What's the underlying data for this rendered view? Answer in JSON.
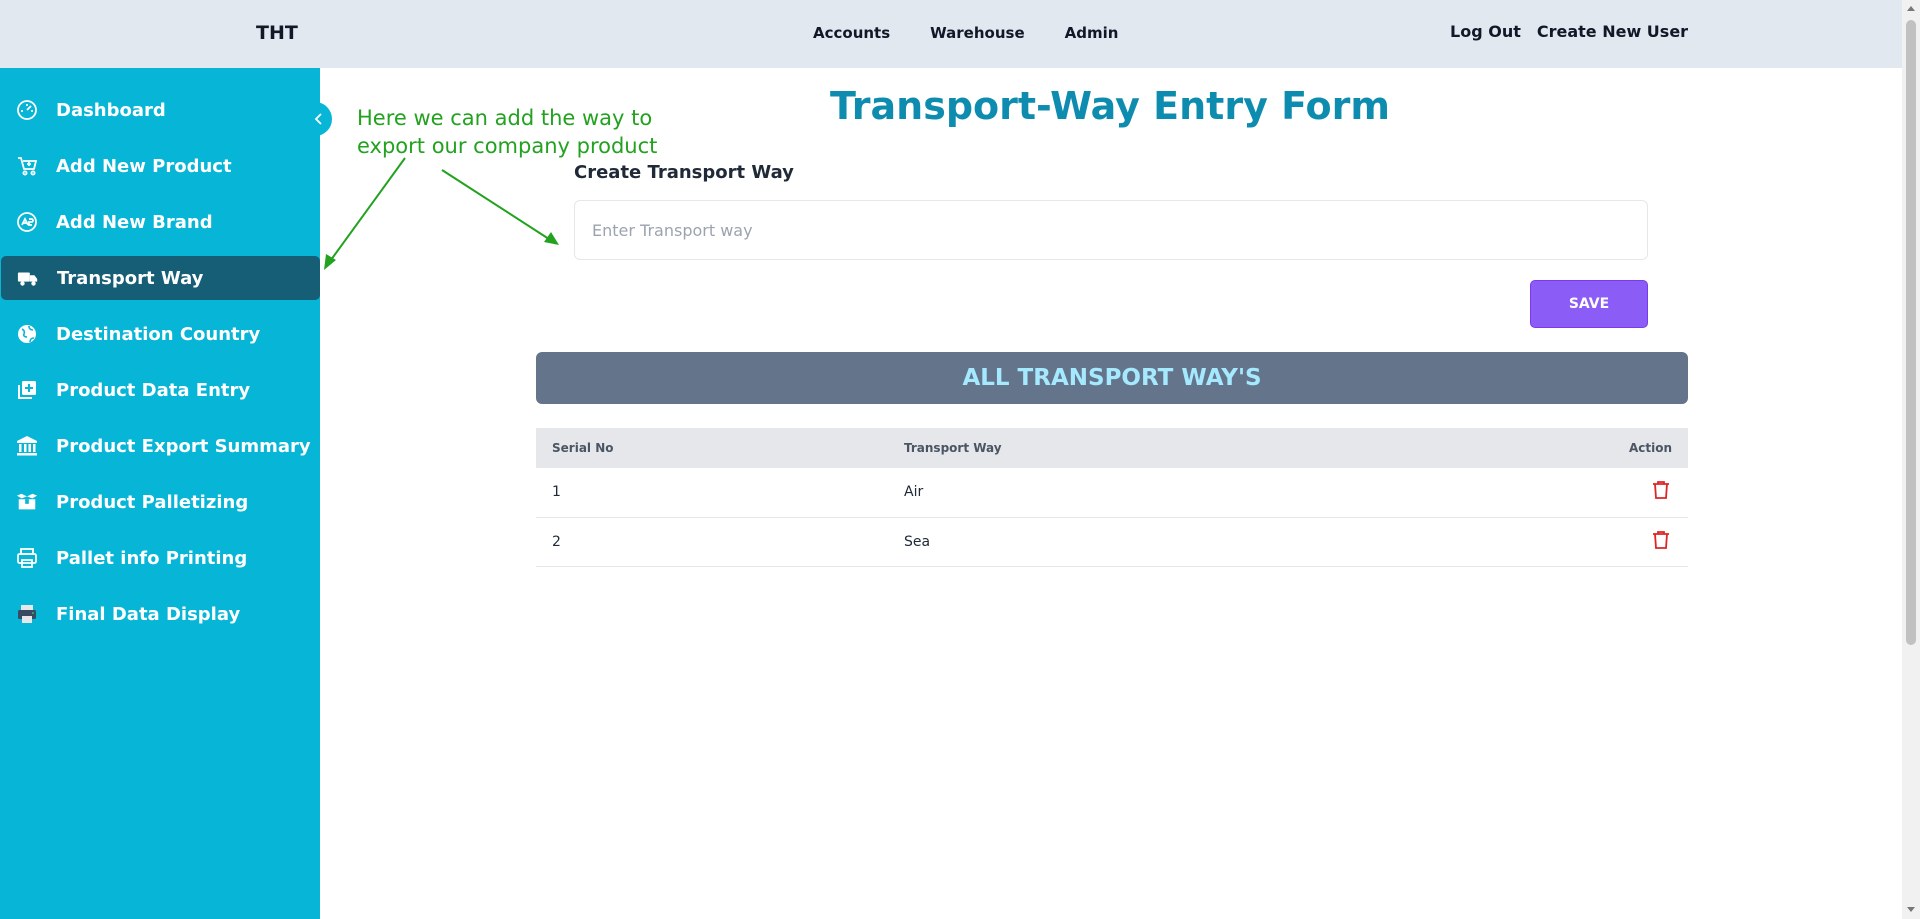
{
  "header": {
    "brand": "THT",
    "nav": [
      "Accounts",
      "Warehouse",
      "Admin"
    ],
    "logout": "Log Out",
    "create_user": "Create New User"
  },
  "sidebar": {
    "active": "Transport Way",
    "items": [
      {
        "label": "Dashboard",
        "icon": "gauge-icon"
      },
      {
        "label": "Add New Product",
        "icon": "cart-plus-icon"
      },
      {
        "label": "Add New Brand",
        "icon": "brand-badge-icon"
      },
      {
        "label": "Transport Way",
        "icon": "truck-icon"
      },
      {
        "label": "Destination Country",
        "icon": "globe-icon"
      },
      {
        "label": "Product Data Entry",
        "icon": "add-box-icon"
      },
      {
        "label": "Product Export Summary",
        "icon": "bank-icon"
      },
      {
        "label": "Product Palletizing",
        "icon": "package-icon"
      },
      {
        "label": "Pallet info Printing",
        "icon": "printer-icon"
      },
      {
        "label": "Final Data Display",
        "icon": "printer-filled-icon"
      }
    ]
  },
  "annotation": {
    "line1": "Here we can add the way to",
    "line2": "export our company product",
    "color": "#22a21f"
  },
  "main": {
    "title": "Transport-Way Entry Form",
    "field_label": "Create Transport Way",
    "input_placeholder": "Enter Transport way",
    "input_value": "",
    "save_label": "SAVE",
    "list_title": "ALL TRANSPORT WAY'S",
    "table": {
      "headers": [
        "Serial No",
        "Transport Way",
        "Action"
      ],
      "rows": [
        {
          "serial": "1",
          "way": "Air"
        },
        {
          "serial": "2",
          "way": "Sea"
        }
      ]
    }
  },
  "colors": {
    "sidebar": "#07b5d6",
    "sidebar_active": "#155e75",
    "title": "#0e8cb0",
    "save": "#8b5cf6",
    "list_header_bg": "#64748b",
    "list_header_text": "#a5e9ff",
    "delete": "#dc2626"
  }
}
